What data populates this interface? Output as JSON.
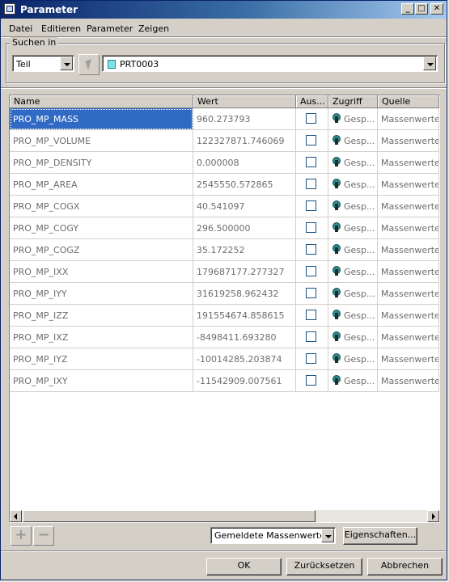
{
  "window": {
    "title": "Parameter",
    "controls": {
      "minimize": "_",
      "maximize": "□",
      "close": "✕"
    }
  },
  "menu": [
    "Datei",
    "Editieren",
    "Parameter",
    "Zeigen"
  ],
  "search": {
    "label": "Suchen in",
    "scope": "Teil",
    "object": "PRT0003"
  },
  "table": {
    "columns": [
      "Name",
      "Wert",
      "Aus...",
      "Zugriff",
      "Quelle"
    ],
    "rows": [
      {
        "name": "PRO_MP_MASS",
        "value": "960.273793",
        "access": "Gesp...",
        "source": "Massenwerte",
        "selected": true,
        "checked": false
      },
      {
        "name": "PRO_MP_VOLUME",
        "value": "122327871.746069",
        "access": "Gesp...",
        "source": "Massenwerte",
        "selected": false,
        "checked": false
      },
      {
        "name": "PRO_MP_DENSITY",
        "value": "0.000008",
        "access": "Gesp...",
        "source": "Massenwerte",
        "selected": false,
        "checked": false
      },
      {
        "name": "PRO_MP_AREA",
        "value": "2545550.572865",
        "access": "Gesp...",
        "source": "Massenwerte",
        "selected": false,
        "checked": false
      },
      {
        "name": "PRO_MP_COGX",
        "value": "40.541097",
        "access": "Gesp...",
        "source": "Massenwerte",
        "selected": false,
        "checked": false
      },
      {
        "name": "PRO_MP_COGY",
        "value": "296.500000",
        "access": "Gesp...",
        "source": "Massenwerte",
        "selected": false,
        "checked": false
      },
      {
        "name": "PRO_MP_COGZ",
        "value": "35.172252",
        "access": "Gesp...",
        "source": "Massenwerte",
        "selected": false,
        "checked": false
      },
      {
        "name": "PRO_MP_IXX",
        "value": "179687177.277327",
        "access": "Gesp...",
        "source": "Massenwerte",
        "selected": false,
        "checked": false
      },
      {
        "name": "PRO_MP_IYY",
        "value": "31619258.962432",
        "access": "Gesp...",
        "source": "Massenwerte",
        "selected": false,
        "checked": false
      },
      {
        "name": "PRO_MP_IZZ",
        "value": "191554674.858615",
        "access": "Gesp...",
        "source": "Massenwerte",
        "selected": false,
        "checked": false
      },
      {
        "name": "PRO_MP_IXZ",
        "value": "-8498411.693280",
        "access": "Gesp...",
        "source": "Massenwerte",
        "selected": false,
        "checked": false
      },
      {
        "name": "PRO_MP_IYZ",
        "value": "-10014285.203874",
        "access": "Gesp...",
        "source": "Massenwerte",
        "selected": false,
        "checked": false
      },
      {
        "name": "PRO_MP_IXY",
        "value": "-11542909.007561",
        "access": "Gesp...",
        "source": "Massenwerte",
        "selected": false,
        "checked": false
      }
    ]
  },
  "toolbar": {
    "add_label": "+",
    "remove_label": "−",
    "filter": "Gemeldete Massenwerte",
    "properties_label": "Eigenschaften..."
  },
  "footer": {
    "ok_label": "OK",
    "reset_label": "Zurücksetzen",
    "cancel_label": "Abbrechen"
  },
  "colors": {
    "selection": "#316ac5",
    "title_gradient_start": "#0a246a",
    "title_gradient_end": "#a6caf0",
    "dialog_face": "#d4d0c8"
  }
}
